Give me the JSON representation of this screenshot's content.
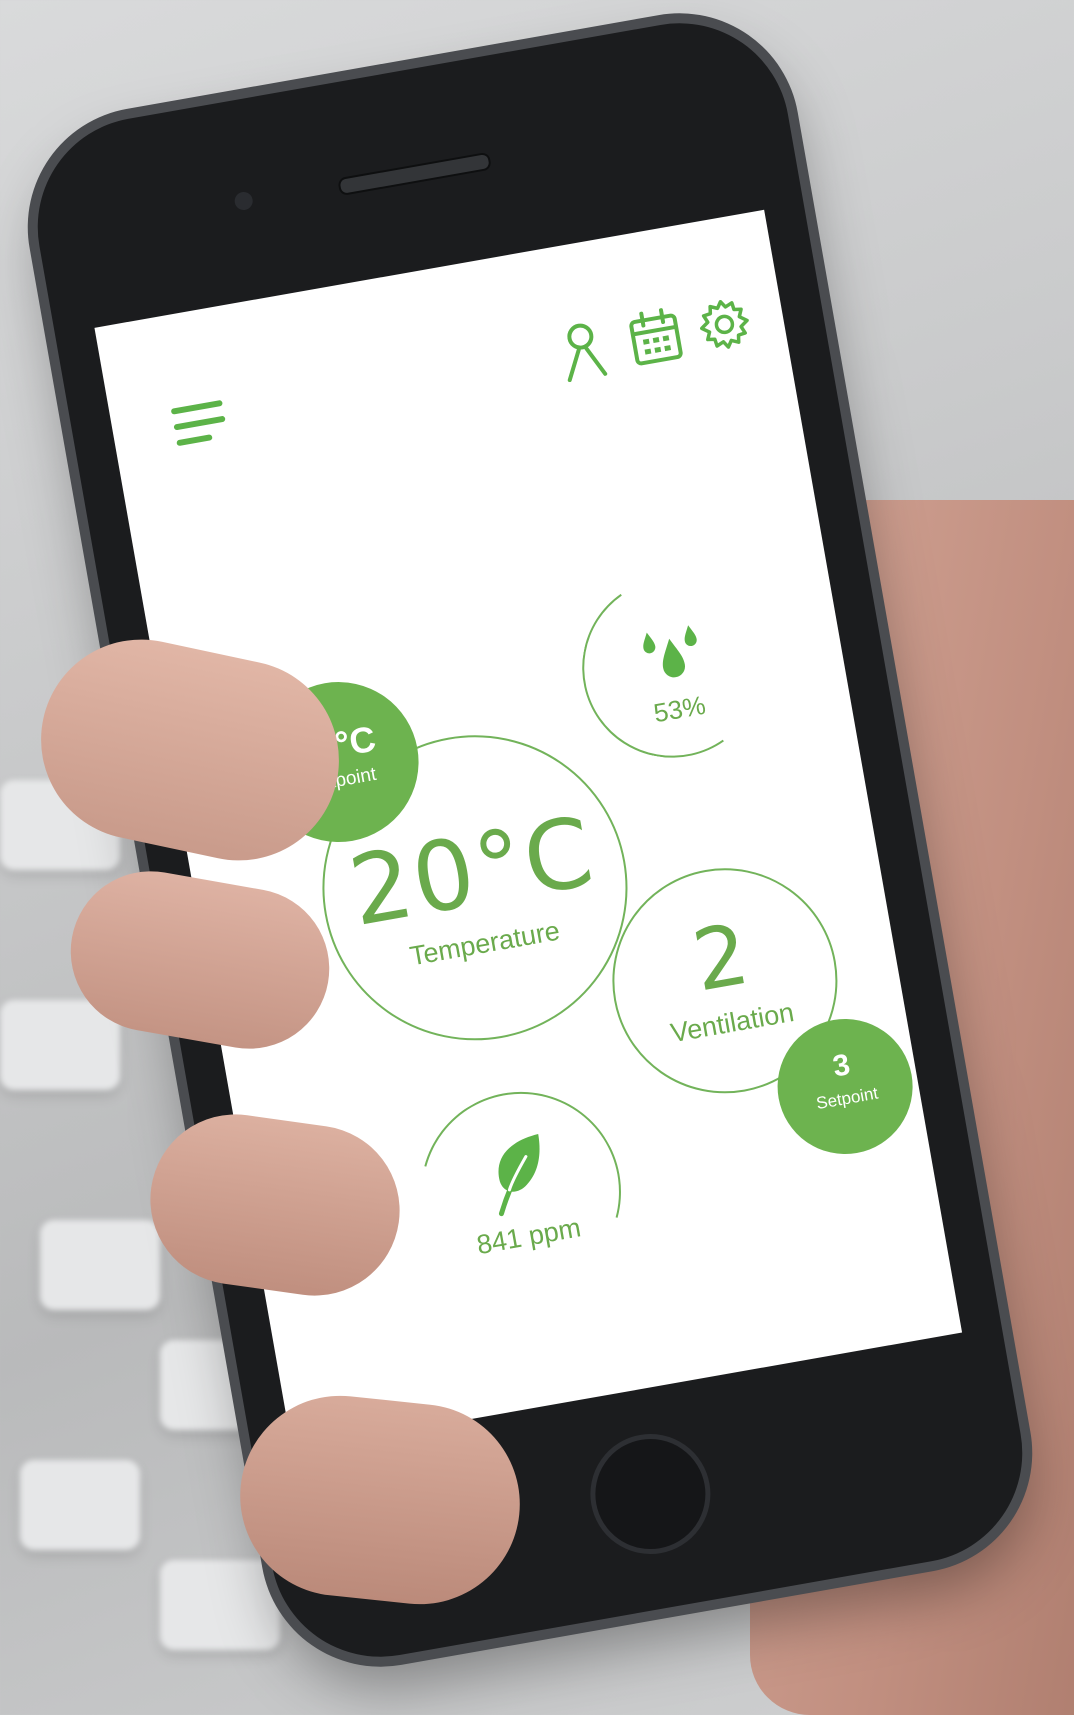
{
  "theme": {
    "accent": "#6db34f",
    "background": "#ffffff"
  },
  "header": {
    "icons": [
      "menu-icon",
      "user-icon",
      "calendar-icon",
      "gear-icon"
    ]
  },
  "temperature": {
    "value": "20°C",
    "label": "Temperature"
  },
  "temperature_setpoint": {
    "value": "21°C",
    "label": "Setpoint"
  },
  "humidity": {
    "icon": "water-drops-icon",
    "value": "53%"
  },
  "ventilation": {
    "value": "2",
    "label": "Ventilation"
  },
  "ventilation_setpoint": {
    "value": "3",
    "label": "Setpoint"
  },
  "co2": {
    "icon": "leaf-icon",
    "value": "841 ppm"
  }
}
